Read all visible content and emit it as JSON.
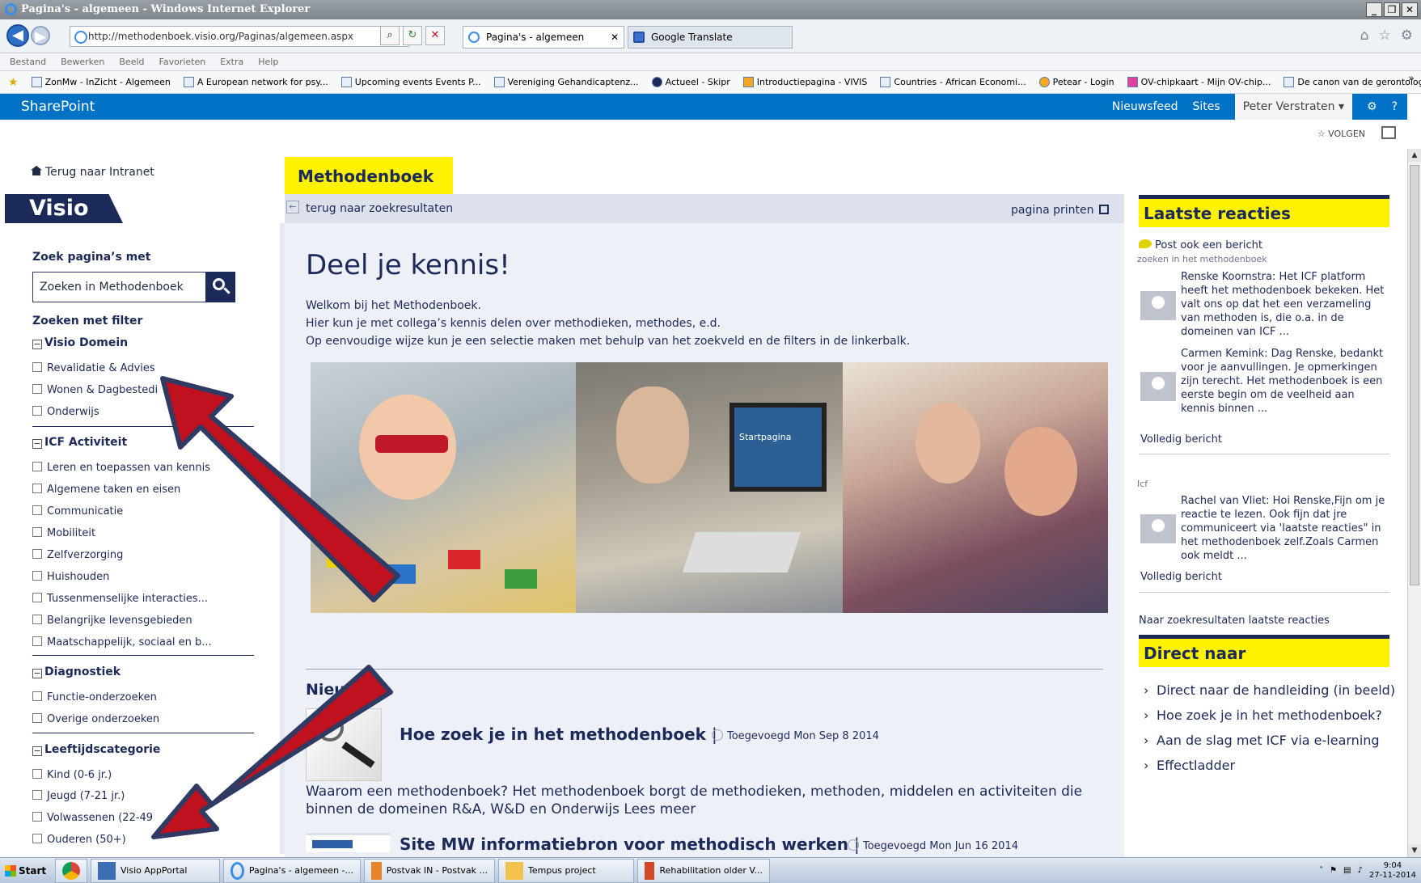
{
  "window": {
    "title": "Pagina's - algemeen - Windows Internet Explorer",
    "controls": [
      "_",
      "\u0000",
      "X"
    ]
  },
  "browser": {
    "url": "http://methodenboek.visio.org/Paginas/algemeen.aspx",
    "tabs": [
      {
        "label": "Pagina's - algemeen",
        "active": true
      },
      {
        "label": "Google Translate",
        "active": false
      }
    ],
    "menu": [
      "Bestand",
      "Bewerken",
      "Beeld",
      "Favorieten",
      "Extra",
      "Help"
    ],
    "favorites": [
      "ZonMw - InZicht - Algemeen",
      "A European network for psy...",
      "Upcoming events Events P...",
      "Vereniging Gehandicaptenz...",
      "Actueel - Skipr",
      "Introductiepagina - VIVIS",
      "Countries - African Economi...",
      "Petear - Login",
      "OV-chipkaart - Mijn OV-chip...",
      "De canon van de gerontologie"
    ]
  },
  "sharepoint": {
    "brand": "SharePoint",
    "newsfeed": "Nieuwsfeed",
    "sites": "Sites",
    "user": "Peter Verstraten",
    "follow": "VOLGEN"
  },
  "leftnav": {
    "home_link": "Terug naar Intranet",
    "logo": "Visio",
    "search_heading": "Zoek pagina’s met",
    "search_placeholder": "Zoeken in Methodenboek",
    "filter_heading": "Zoeken met filter",
    "groups": [
      {
        "title": "Visio Domein",
        "options": [
          "Revalidatie & Advies",
          "Wonen & Dagbestedi",
          "Onderwijs"
        ]
      },
      {
        "title": "ICF Activiteit",
        "options": [
          "Leren en toepassen van kennis",
          "Algemene taken en eisen",
          "Communicatie",
          "Mobiliteit",
          "Zelfverzorging",
          "Huishouden",
          "Tussenmenselijke interacties...",
          "Belangrijke levensgebieden",
          "Maatschappelijk, sociaal en b..."
        ]
      },
      {
        "title": "Diagnostiek",
        "options": [
          "Functie-onderzoeken",
          "Overige onderzoeken"
        ]
      },
      {
        "title": "Leeftijdscategorie",
        "options": [
          "Kind (0-6 jr.)",
          "Jeugd (7-21 jr.)",
          "Volwassenen (22-49",
          "Ouderen (50+)"
        ]
      }
    ]
  },
  "main": {
    "tab_label": "Methodenboek",
    "back_link": "terug naar zoekresultaten",
    "print_link": "pagina printen",
    "title": "Deel je kennis!",
    "intro": [
      "Welkom bij het Methodenboek.",
      "Hier kun je met collega’s kennis delen over methodieken, methodes, e.d.",
      "Op eenvoudige wijze kun je een selectie maken met behulp van het zoekveld en de filters in de linkerbalk."
    ],
    "photo_screen_text": "Startpagina",
    "news_heading": "Nieu",
    "news": [
      {
        "title": "Hoe zoek je in het methodenboek",
        "date": "Toegevoegd Mon Sep 8 2014",
        "body": "Waarom een methodenboek? Het methodenboek borgt de methodieken, methoden, middelen en activiteiten die binnen de domeinen R&A, W&D en Onderwijs Lees meer"
      },
      {
        "title": "Site MW informatiebron voor methodisch werken",
        "date": "Toegevoegd Mon Jun 16 2014"
      }
    ]
  },
  "right": {
    "reactions_heading": "Laatste reacties",
    "post_link": "Post ook een bericht",
    "post_sub": "zoeken in het methodenboek",
    "comments": [
      "Renske Koornstra: Het ICF platform heeft het methodenboek bekeken. Het valt ons op dat het een verzameling van methoden is, die o.a.  in de domeinen van ICF ...",
      "Carmen Kemink: Dag Renske, bedankt voor je aanvullingen. Je opmerkingen zijn terecht. Het methodenboek is een eerste begin om de veelheid aan kennis binnen ...",
      "Rachel van Vliet: Hoi Renske,Fijn om je reactie te lezen. Ook fijn dat jre communiceert via 'laatste reacties\" in het methodenboek zelf.Zoals Carmen ook meldt ..."
    ],
    "full_message": "Volledig bericht",
    "topic2": "Icf",
    "all_results": "Naar zoekresultaten laatste reacties",
    "direct_heading": "Direct naar",
    "direct_links": [
      "Direct naar de handleiding (in beeld)",
      "Hoe zoek je in het methodenboek?",
      "Aan de slag met ICF via e-learning",
      "Effectladder"
    ]
  },
  "taskbar": {
    "start": "Start",
    "items": [
      "Visio AppPortal",
      "Pagina's - algemeen -...",
      "Postvak IN - Postvak ...",
      "Tempus project",
      "Rehabilitation older V..."
    ],
    "time": "9:04",
    "date": "27-11-2014"
  },
  "colors": {
    "accent_yellow": "#fff200",
    "navy": "#1c2a5a",
    "sharepoint_blue": "#0072c6",
    "arrow_red": "#c0111f"
  }
}
